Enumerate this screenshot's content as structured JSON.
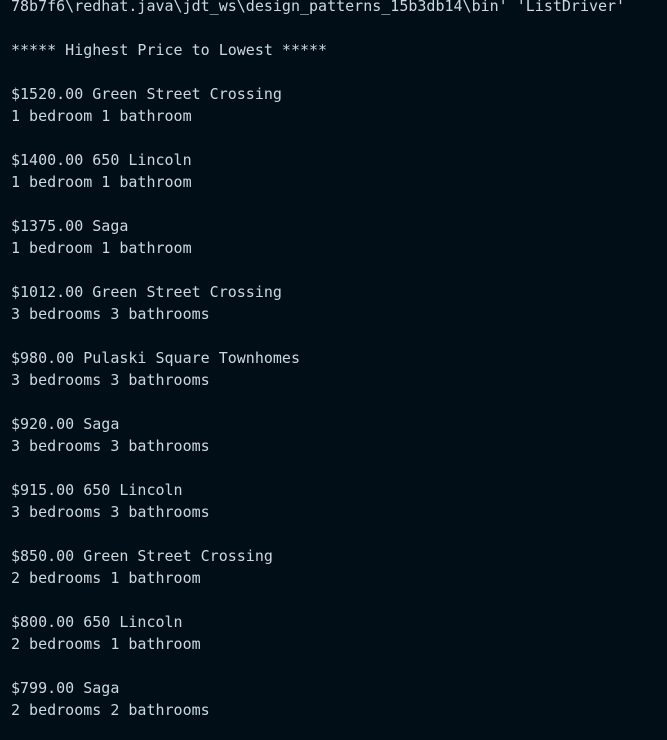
{
  "terminal": {
    "command_line": "78b7f6\\redhat.java\\jdt_ws\\design_patterns_15b3db14\\bin' 'ListDriver'",
    "heading": "***** Highest Price to Lowest *****",
    "listings": [
      {
        "price_name": "$1520.00 Green Street Crossing",
        "rooms": "1 bedroom 1 bathroom"
      },
      {
        "price_name": "$1400.00 650 Lincoln",
        "rooms": "1 bedroom 1 bathroom"
      },
      {
        "price_name": "$1375.00 Saga",
        "rooms": "1 bedroom 1 bathroom"
      },
      {
        "price_name": "$1012.00 Green Street Crossing",
        "rooms": "3 bedrooms 3 bathrooms"
      },
      {
        "price_name": "$980.00 Pulaski Square Townhomes",
        "rooms": "3 bedrooms 3 bathrooms"
      },
      {
        "price_name": "$920.00 Saga",
        "rooms": "3 bedrooms 3 bathrooms"
      },
      {
        "price_name": "$915.00 650 Lincoln",
        "rooms": "3 bedrooms 3 bathrooms"
      },
      {
        "price_name": "$850.00 Green Street Crossing",
        "rooms": "2 bedrooms 1 bathroom"
      },
      {
        "price_name": "$800.00 650 Lincoln",
        "rooms": "2 bedrooms 1 bathroom"
      },
      {
        "price_name": "$799.00 Saga",
        "rooms": "2 bedrooms 2 bathrooms"
      }
    ]
  },
  "colors": {
    "background": "#010e18",
    "text": "#cfd6dd"
  }
}
